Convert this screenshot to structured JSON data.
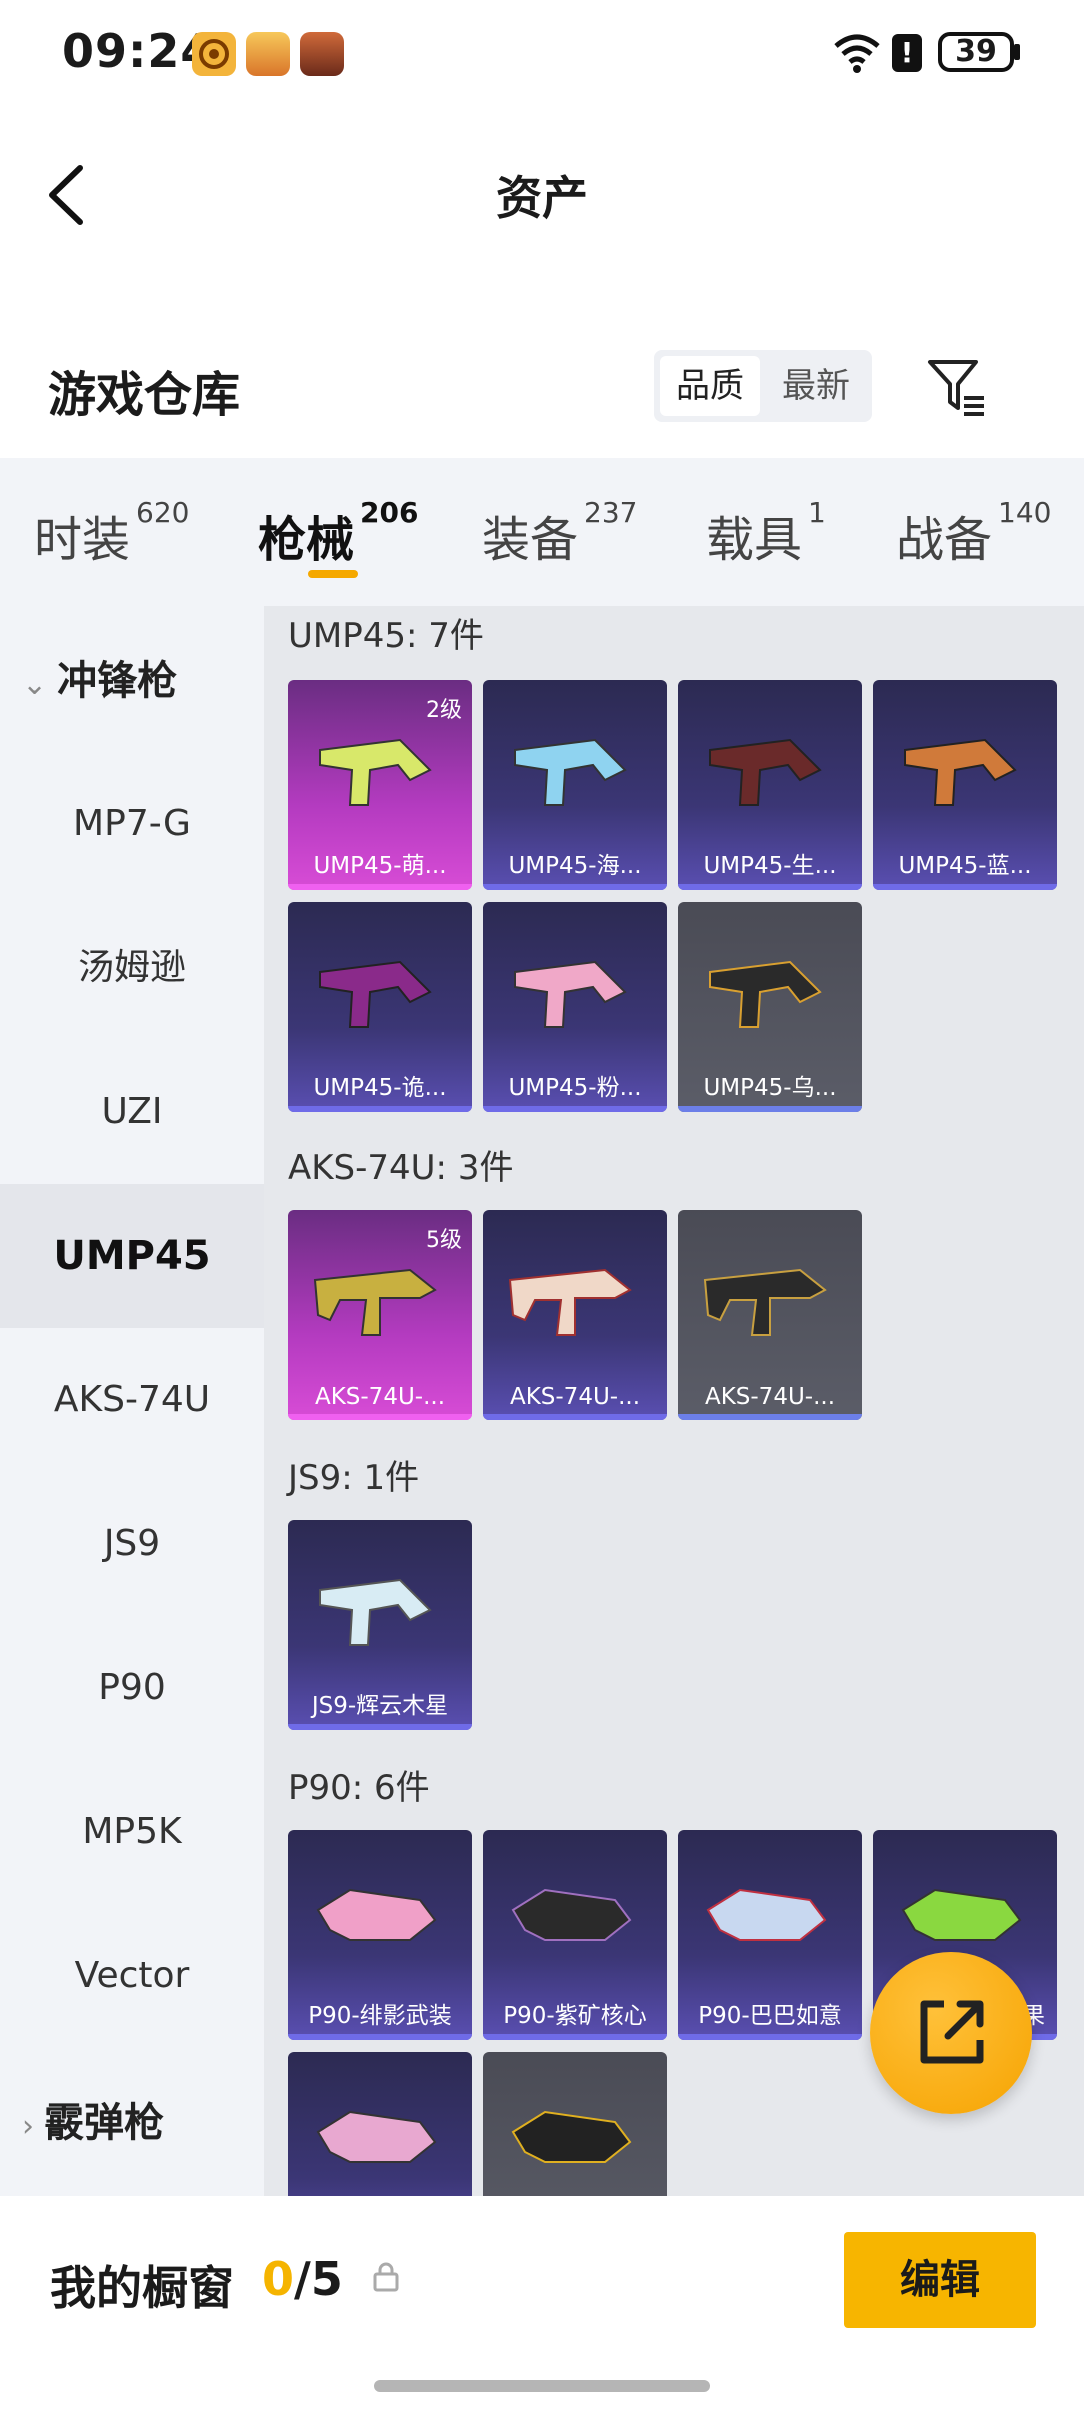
{
  "status_bar": {
    "time": "09:24",
    "battery": "39",
    "alert": "!"
  },
  "header": {
    "title": "资产"
  },
  "section": {
    "title": "游戏仓库",
    "sort_options": [
      "品质",
      "最新"
    ]
  },
  "tabs": [
    {
      "label": "时装",
      "count": "620"
    },
    {
      "label": "枪械",
      "count": "206"
    },
    {
      "label": "装备",
      "count": "237"
    },
    {
      "label": "载具",
      "count": "1"
    },
    {
      "label": "战备",
      "count": "140"
    }
  ],
  "sidebar": {
    "group_smg": "冲锋枪",
    "items": [
      "MP7-G",
      "汤姆逊",
      "UZI",
      "UMP45",
      "AKS-74U",
      "JS9",
      "P90",
      "MP5K",
      "Vector"
    ],
    "group_shotgun": "霰弹枪"
  },
  "groups": [
    {
      "title": "UMP45: 7件",
      "items": [
        {
          "label": "UMP45-萌...",
          "level": "2级"
        },
        {
          "label": "UMP45-海..."
        },
        {
          "label": "UMP45-生..."
        },
        {
          "label": "UMP45-蓝..."
        },
        {
          "label": "UMP45-诡..."
        },
        {
          "label": "UMP45-粉..."
        },
        {
          "label": "UMP45-乌..."
        }
      ]
    },
    {
      "title": "AKS-74U: 3件",
      "items": [
        {
          "label": "AKS-74U-...",
          "level": "5级"
        },
        {
          "label": "AKS-74U-..."
        },
        {
          "label": "AKS-74U-..."
        }
      ]
    },
    {
      "title": "JS9: 1件",
      "items": [
        {
          "label": "JS9-辉云木星"
        }
      ]
    },
    {
      "title": "P90: 6件",
      "items": [
        {
          "label": "P90-绯影武装"
        },
        {
          "label": "P90-紫矿核心"
        },
        {
          "label": "P90-巴巴如意"
        },
        {
          "label": "果"
        }
      ]
    }
  ],
  "bottom": {
    "window_label": "我的橱窗",
    "window_current": "0",
    "window_total": "/5",
    "edit_label": "编辑"
  },
  "colors": {
    "accent": "#f7b500",
    "legendary": "#d84cd6",
    "epic": "#5a4fb2",
    "rare": "#5b5d68"
  }
}
